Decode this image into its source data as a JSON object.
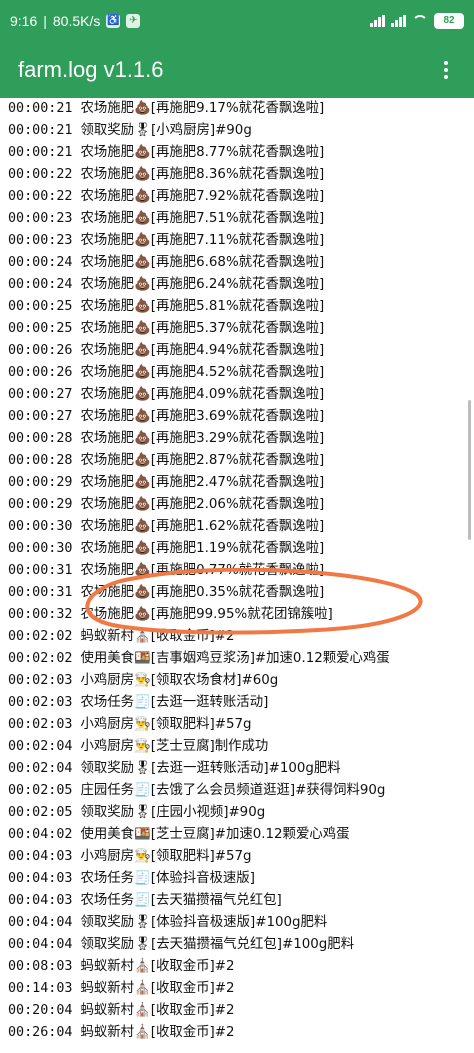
{
  "status_bar": {
    "time": "9:16",
    "speed": "80.5K/s",
    "battery": "82"
  },
  "app_bar": {
    "title": "farm.log v1.1.6",
    "menu_icon": "more-vert-icon"
  },
  "colors": {
    "primary": "#2e9e5a",
    "highlight": "#f07a45"
  },
  "log_lines": [
    {
      "time": "00:00:21",
      "text": "农场施肥💩[再施肥9.17%就花香飘逸啦]"
    },
    {
      "time": "00:00:21",
      "text": "领取奖励🎖[小鸡厨房]#90g"
    },
    {
      "time": "00:00:21",
      "text": "农场施肥💩[再施肥8.77%就花香飘逸啦]"
    },
    {
      "time": "00:00:22",
      "text": "农场施肥💩[再施肥8.36%就花香飘逸啦]"
    },
    {
      "time": "00:00:22",
      "text": "农场施肥💩[再施肥7.92%就花香飘逸啦]"
    },
    {
      "time": "00:00:23",
      "text": "农场施肥💩[再施肥7.51%就花香飘逸啦]"
    },
    {
      "time": "00:00:23",
      "text": "农场施肥💩[再施肥7.11%就花香飘逸啦]"
    },
    {
      "time": "00:00:24",
      "text": "农场施肥💩[再施肥6.68%就花香飘逸啦]"
    },
    {
      "time": "00:00:24",
      "text": "农场施肥💩[再施肥6.24%就花香飘逸啦]"
    },
    {
      "time": "00:00:25",
      "text": "农场施肥💩[再施肥5.81%就花香飘逸啦]"
    },
    {
      "time": "00:00:25",
      "text": "农场施肥💩[再施肥5.37%就花香飘逸啦]"
    },
    {
      "time": "00:00:26",
      "text": "农场施肥💩[再施肥4.94%就花香飘逸啦]"
    },
    {
      "time": "00:00:26",
      "text": "农场施肥💩[再施肥4.52%就花香飘逸啦]"
    },
    {
      "time": "00:00:27",
      "text": "农场施肥💩[再施肥4.09%就花香飘逸啦]"
    },
    {
      "time": "00:00:27",
      "text": "农场施肥💩[再施肥3.69%就花香飘逸啦]"
    },
    {
      "time": "00:00:28",
      "text": "农场施肥💩[再施肥3.29%就花香飘逸啦]"
    },
    {
      "time": "00:00:28",
      "text": "农场施肥💩[再施肥2.87%就花香飘逸啦]"
    },
    {
      "time": "00:00:29",
      "text": "农场施肥💩[再施肥2.47%就花香飘逸啦]"
    },
    {
      "time": "00:00:29",
      "text": "农场施肥💩[再施肥2.06%就花香飘逸啦]"
    },
    {
      "time": "00:00:30",
      "text": "农场施肥💩[再施肥1.62%就花香飘逸啦]"
    },
    {
      "time": "00:00:30",
      "text": "农场施肥💩[再施肥1.19%就花香飘逸啦]"
    },
    {
      "time": "00:00:31",
      "text": "农场施肥💩[再施肥0.77%就花香飘逸啦]"
    },
    {
      "time": "00:00:31",
      "text": "农场施肥💩[再施肥0.35%就花香飘逸啦]"
    },
    {
      "time": "00:00:32",
      "text": "农场施肥💩[再施肥99.95%就花团锦簇啦]"
    },
    {
      "time": "00:02:02",
      "text": "蚂蚁新村⛪[收取金币]#2"
    },
    {
      "time": "00:02:02",
      "text": "使用美食🍱[吉事姻鸡豆浆汤]#加速0.12颗爱心鸡蛋"
    },
    {
      "time": "00:02:03",
      "text": "小鸡厨房👨‍🍳[领取农场食材]#60g"
    },
    {
      "time": "00:02:03",
      "text": "农场任务🧾[去逛一逛转账活动]"
    },
    {
      "time": "00:02:03",
      "text": "小鸡厨房👨‍🍳[领取肥料]#57g"
    },
    {
      "time": "00:02:04",
      "text": "小鸡厨房👨‍🍳[芝士豆腐]制作成功"
    },
    {
      "time": "00:02:04",
      "text": "领取奖励🎖[去逛一逛转账活动]#100g肥料"
    },
    {
      "time": "00:02:05",
      "text": "庄园任务🧾[去饿了么会员频道逛逛]#获得饲料90g"
    },
    {
      "time": "00:02:05",
      "text": "领取奖励🎖[庄园小视频]#90g"
    },
    {
      "time": "00:04:02",
      "text": "使用美食🍱[芝士豆腐]#加速0.12颗爱心鸡蛋"
    },
    {
      "time": "00:04:03",
      "text": "小鸡厨房👨‍🍳[领取肥料]#57g"
    },
    {
      "time": "00:04:03",
      "text": "农场任务🧾[体验抖音极速版]"
    },
    {
      "time": "00:04:03",
      "text": "农场任务🧾[去天猫攒福气兑红包]"
    },
    {
      "time": "00:04:04",
      "text": "领取奖励🎖[体验抖音极速版]#100g肥料"
    },
    {
      "time": "00:04:04",
      "text": "领取奖励🎖[去天猫攒福气兑红包]#100g肥料"
    },
    {
      "time": "00:08:03",
      "text": "蚂蚁新村⛪[收取金币]#2"
    },
    {
      "time": "00:14:03",
      "text": "蚂蚁新村⛪[收取金币]#2"
    },
    {
      "time": "00:20:04",
      "text": "蚂蚁新村⛪[收取金币]#2"
    },
    {
      "time": "00:26:04",
      "text": "蚂蚁新村⛪[收取金币]#2"
    }
  ]
}
